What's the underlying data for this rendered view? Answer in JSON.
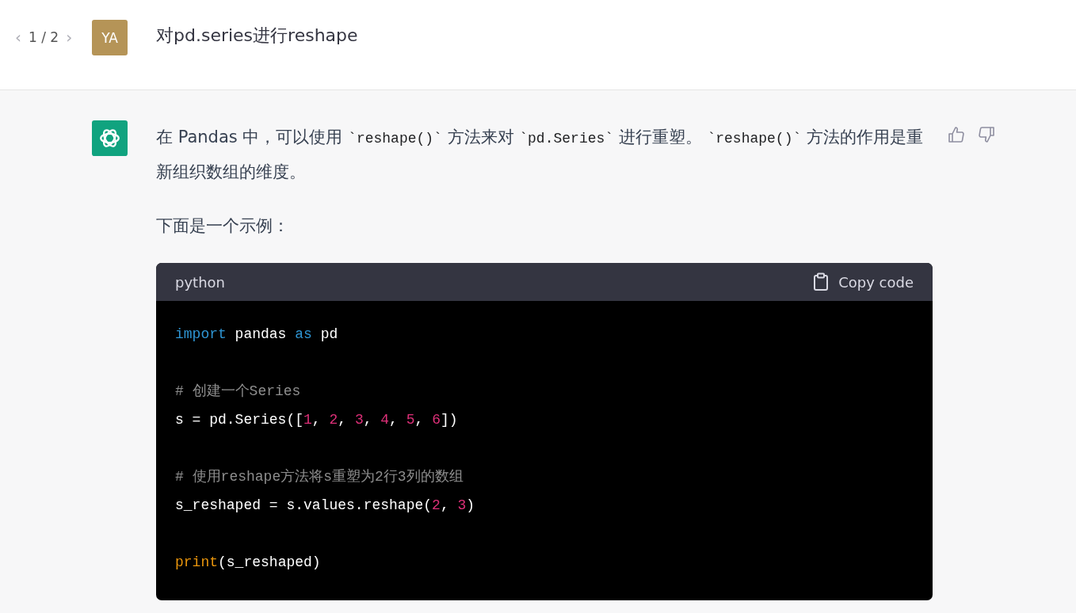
{
  "pager": {
    "prev": "‹",
    "count": "1 / 2",
    "next": "›"
  },
  "user": {
    "avatar": "YA",
    "message": "对pd.series进行reshape"
  },
  "reply": {
    "paragraphs": [
      {
        "segments": [
          {
            "kind": "text",
            "text": "在 Pandas 中，可以使用 "
          },
          {
            "kind": "code",
            "text": "`reshape()`"
          },
          {
            "kind": "text",
            "text": " 方法来对 "
          },
          {
            "kind": "code",
            "text": "`pd.Series`"
          },
          {
            "kind": "text",
            "text": " 进行重塑。 "
          },
          {
            "kind": "code",
            "text": "`reshape()`"
          },
          {
            "kind": "text",
            "text": " 方法的作用是重新组织数组的维度。"
          }
        ]
      },
      {
        "segments": [
          {
            "kind": "text",
            "text": "下面是一个示例："
          }
        ]
      }
    ],
    "code_block": {
      "language": "python",
      "copy_label": "Copy code",
      "groups": [
        [
          [
            {
              "kind": "keyword",
              "text": "import"
            },
            {
              "kind": "plain",
              "text": " pandas "
            },
            {
              "kind": "keyword",
              "text": "as"
            },
            {
              "kind": "plain",
              "text": " pd"
            }
          ]
        ],
        [
          [
            {
              "kind": "comment",
              "text": "# 创建一个Series"
            }
          ],
          [
            {
              "kind": "plain",
              "text": "s = pd.Series(["
            },
            {
              "kind": "number",
              "text": "1"
            },
            {
              "kind": "plain",
              "text": ", "
            },
            {
              "kind": "number",
              "text": "2"
            },
            {
              "kind": "plain",
              "text": ", "
            },
            {
              "kind": "number",
              "text": "3"
            },
            {
              "kind": "plain",
              "text": ", "
            },
            {
              "kind": "number",
              "text": "4"
            },
            {
              "kind": "plain",
              "text": ", "
            },
            {
              "kind": "number",
              "text": "5"
            },
            {
              "kind": "plain",
              "text": ", "
            },
            {
              "kind": "number",
              "text": "6"
            },
            {
              "kind": "plain",
              "text": "])"
            }
          ]
        ],
        [
          [
            {
              "kind": "comment",
              "text": "# 使用reshape方法将s重塑为2行3列的数组"
            }
          ],
          [
            {
              "kind": "plain",
              "text": "s_reshaped = s.values.reshape("
            },
            {
              "kind": "number",
              "text": "2"
            },
            {
              "kind": "plain",
              "text": ", "
            },
            {
              "kind": "number",
              "text": "3"
            },
            {
              "kind": "plain",
              "text": ")"
            }
          ]
        ],
        [
          [
            {
              "kind": "builtin",
              "text": "print"
            },
            {
              "kind": "plain",
              "text": "(s_reshaped)"
            }
          ]
        ]
      ]
    }
  }
}
